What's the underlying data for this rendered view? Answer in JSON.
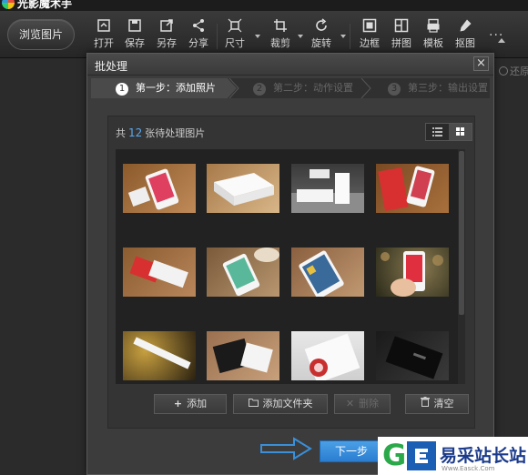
{
  "app": {
    "title": "光影魔术手"
  },
  "toolbar": {
    "browse_label": "浏览图片",
    "tools": [
      {
        "label": "打开",
        "icon": "open-icon"
      },
      {
        "label": "保存",
        "icon": "save-icon"
      },
      {
        "label": "另存",
        "icon": "save-as-icon"
      },
      {
        "label": "分享",
        "icon": "share-icon"
      },
      {
        "label": "尺寸",
        "icon": "resize-icon"
      },
      {
        "label": "裁剪",
        "icon": "crop-icon"
      },
      {
        "label": "旋转",
        "icon": "rotate-icon"
      },
      {
        "label": "边框",
        "icon": "border-icon"
      },
      {
        "label": "拼图",
        "icon": "collage-icon"
      },
      {
        "label": "模板",
        "icon": "template-icon"
      },
      {
        "label": "抠图",
        "icon": "cutout-icon"
      }
    ],
    "more_label": "..."
  },
  "background": {
    "restore_label": "还原"
  },
  "dialog": {
    "title": "批处理",
    "close_label": "×",
    "steps": [
      {
        "num": "1",
        "label": "第一步：添加照片",
        "active": true
      },
      {
        "num": "2",
        "label": "第二步：动作设置",
        "active": false
      },
      {
        "num": "3",
        "label": "第三步：输出设置",
        "active": false
      }
    ],
    "count_prefix": "共",
    "count": "12",
    "count_suffix": "张待处理图片",
    "thumbnails": [
      {
        "name": "photo-01"
      },
      {
        "name": "photo-02"
      },
      {
        "name": "photo-03"
      },
      {
        "name": "photo-04"
      },
      {
        "name": "photo-05"
      },
      {
        "name": "photo-06"
      },
      {
        "name": "photo-07"
      },
      {
        "name": "photo-08"
      },
      {
        "name": "photo-09"
      },
      {
        "name": "photo-10"
      },
      {
        "name": "photo-11"
      },
      {
        "name": "photo-12"
      }
    ],
    "actions": {
      "add": "添加",
      "add_folder": "添加文件夹",
      "delete": "删除",
      "clear": "清空"
    },
    "next_label": "下一步"
  },
  "watermark": {
    "text": "易采站长站",
    "url": "Www.Easck.Com"
  },
  "colors": {
    "accent": "#2a7dd1",
    "count": "#5aaaf0",
    "arrow": "#3a8fd8"
  }
}
